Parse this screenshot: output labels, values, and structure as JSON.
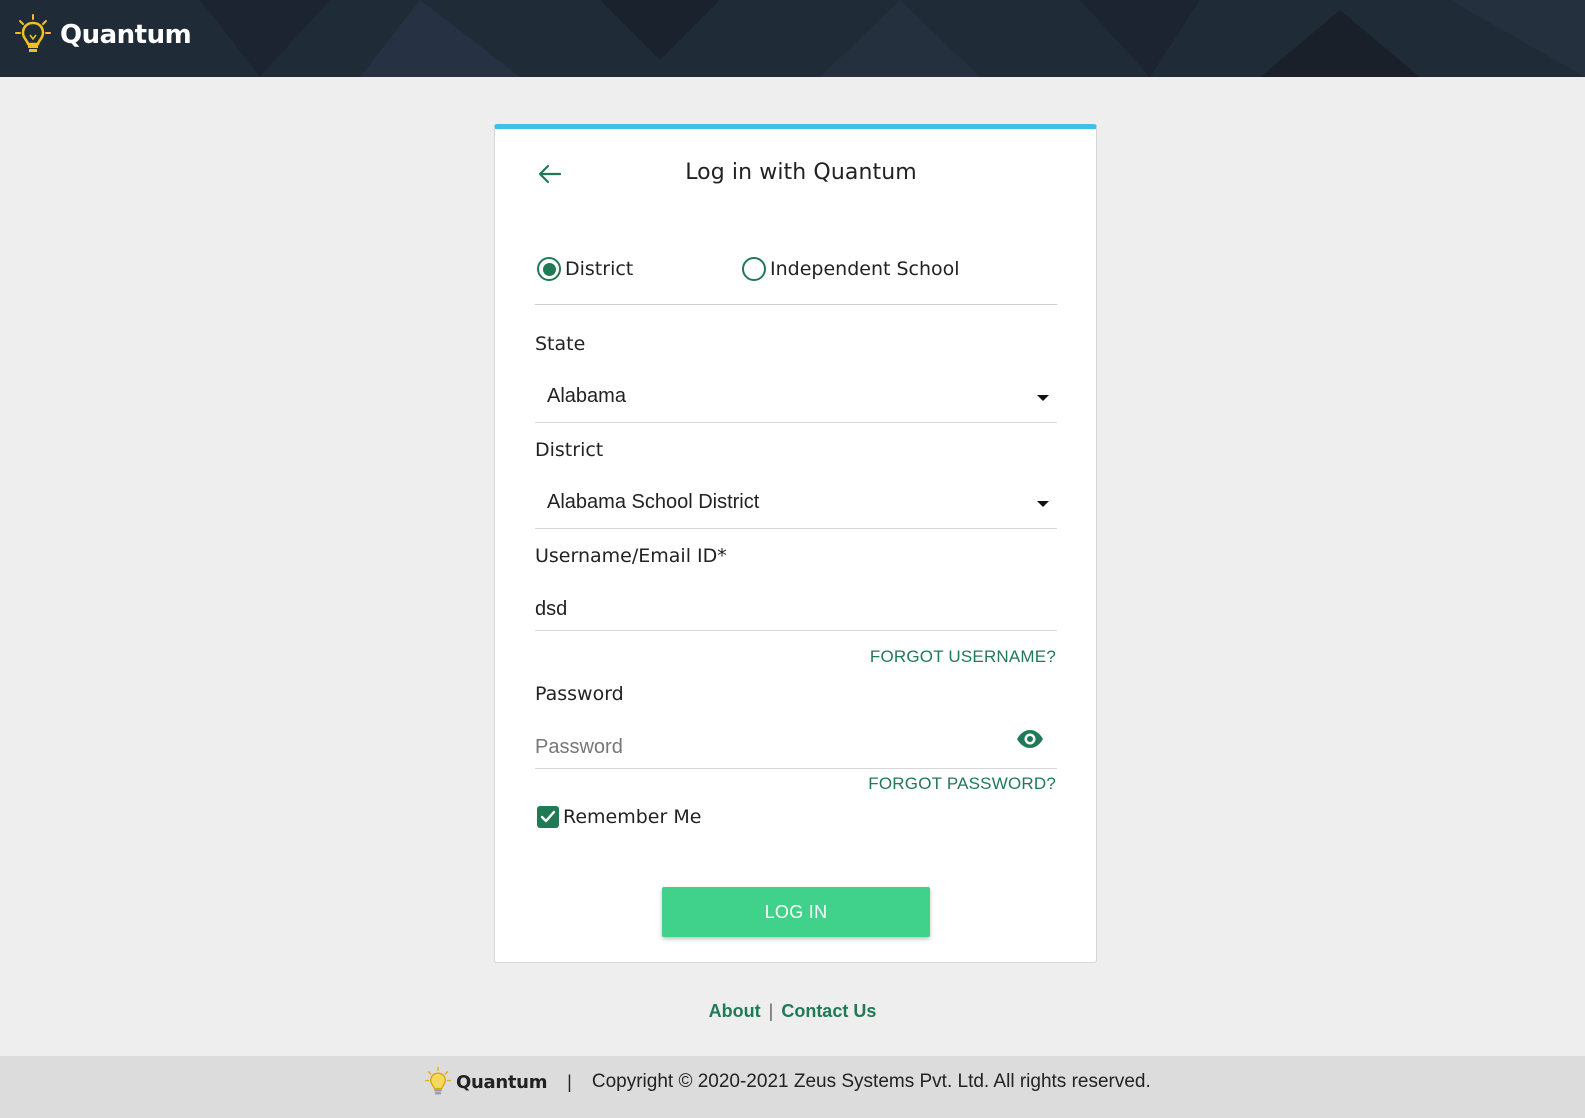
{
  "header": {
    "app_name": "Quantum"
  },
  "login": {
    "title": "Log in with Quantum",
    "login_type_options": [
      {
        "label": "District",
        "selected": true
      },
      {
        "label": "Independent School",
        "selected": false
      }
    ],
    "state": {
      "label": "State",
      "value": "Alabama"
    },
    "district": {
      "label": "District",
      "value": "Alabama School District"
    },
    "username": {
      "label": "Username/Email ID*",
      "value": "dsd"
    },
    "forgot_username": "FORGOT USERNAME?",
    "password": {
      "label": "Password",
      "placeholder": "Password",
      "value": ""
    },
    "forgot_password": "FORGOT PASSWORD?",
    "remember_me": {
      "label": "Remember Me",
      "checked": true
    },
    "login_button": "LOG IN"
  },
  "footer": {
    "links": [
      "About",
      "Contact Us"
    ],
    "separator": "|",
    "brand": "Quantum",
    "copyright": "Copyright © 2020-2021 Zeus Systems Pvt. Ltd. All rights reserved."
  },
  "colors": {
    "header_bg": "#202b38",
    "accent_green": "#1f7a55",
    "button_green": "#40d18a",
    "card_top_border": "#3ec1e6"
  }
}
